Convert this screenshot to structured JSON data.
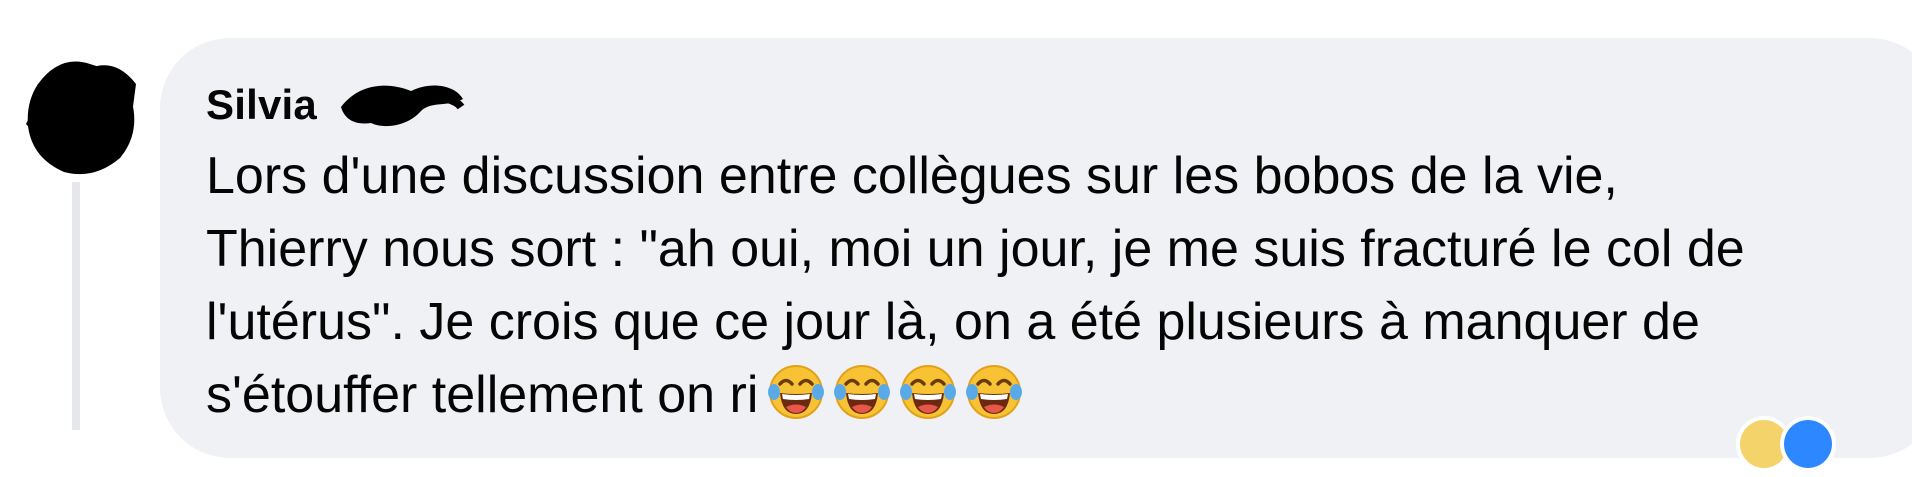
{
  "comment": {
    "author": "Silvia",
    "text_lines": [
      "Lors d'une discussion entre collègues sur les bobos de la vie,",
      "Thierry nous sort : \"ah oui, moi un jour, je me suis fracturé le col de",
      "l'utérus\". Je crois que ce jour là, on a été plusieurs à manquer de",
      "s'étouffer tellement on ri"
    ],
    "trailing_emojis": [
      "face-with-tears-of-joy-icon",
      "face-with-tears-of-joy-icon",
      "face-with-tears-of-joy-icon",
      "face-with-tears-of-joy-icon"
    ]
  },
  "colors": {
    "bubble_bg": "#f0f1f4",
    "text": "#050505",
    "thread_line": "#e6e7ea",
    "redaction": "#000000"
  }
}
